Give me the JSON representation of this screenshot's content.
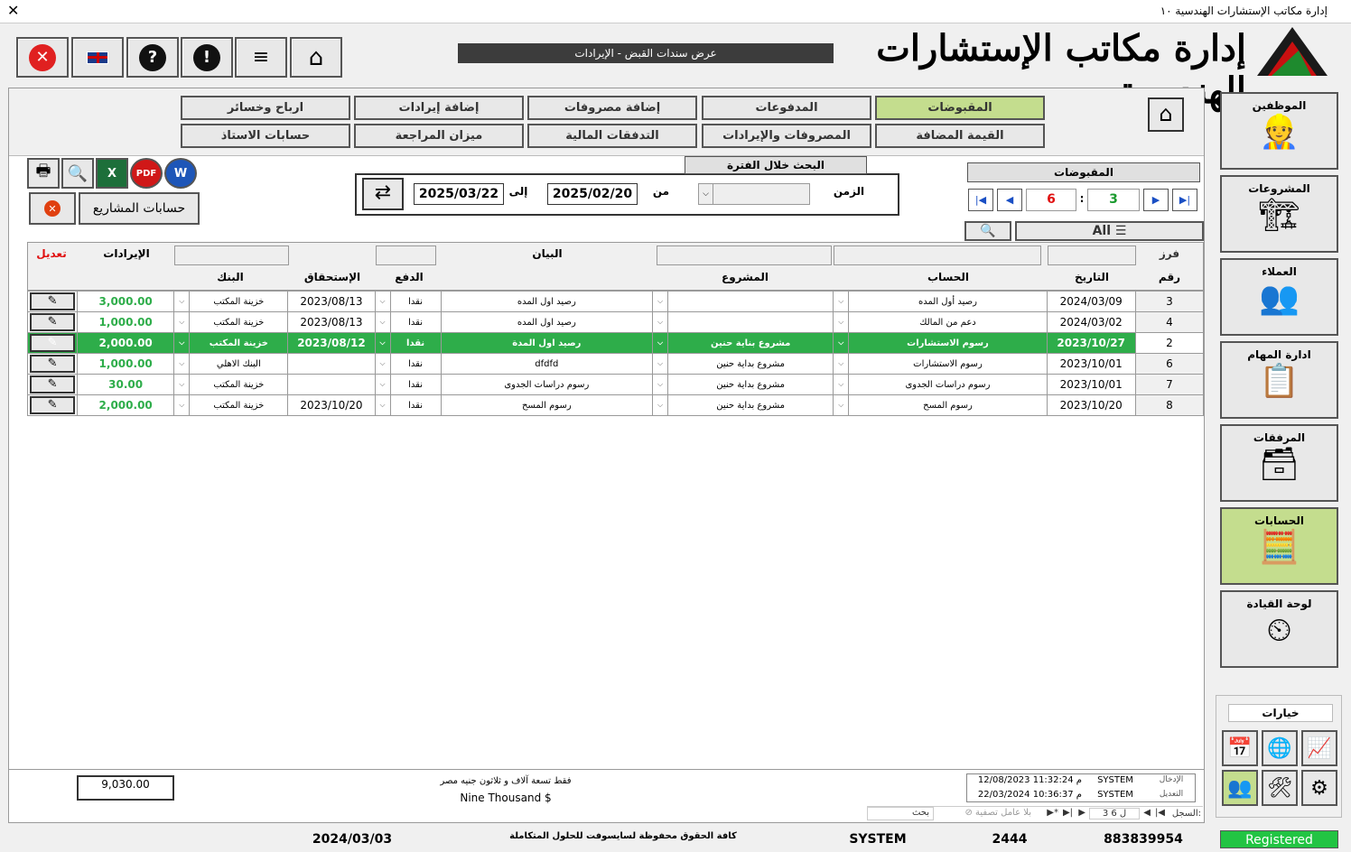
{
  "window": {
    "title": "إدارة مكاتب الإستشارات الهندسية ١٠"
  },
  "form_title": "عرض سندات القبض - الإيرادات",
  "logo_text": "إدارة مكاتب الإستشارات الهندسية",
  "tabs_row1": [
    "المقبوضات",
    "المدفوعات",
    "إضافة مصروفات",
    "إضافة إيرادات",
    "ارباح وخسائر"
  ],
  "tabs_row2": [
    "القيمة المضافة",
    "المصروفات والإيرادات",
    "التدفقات المالية",
    "ميزان المراجعة",
    "حسابات الاستاذ"
  ],
  "side": [
    "الموظفين",
    "المشروعات",
    "العملاء",
    "ادارة المهام",
    "المرفقات",
    "الحسابات",
    "لوحة القيادة"
  ],
  "options_label": "خيارات",
  "projects_accounts": "حسابات المشاريع",
  "search_period": {
    "title": "البحث خلال الفترة",
    "time_label": "الزمن",
    "from_label": "من",
    "to_label": "إلى",
    "from": "2025/02/20",
    "to": "2025/03/22"
  },
  "nav": {
    "title": "المقبوضات",
    "current": "3",
    "total": "6",
    "sep": ":"
  },
  "filter_all": "All",
  "sort_label": "فرز",
  "num_label": "رقم",
  "edit_label": "تعديل",
  "headers": {
    "income": "الإيرادات",
    "bank": "البنك",
    "due": "الإستحقاق",
    "pay": "الدفع",
    "statement": "البيان",
    "project": "المشروع",
    "account": "الحساب",
    "date": "التاريخ"
  },
  "rows": [
    {
      "num": "3",
      "date": "2024/03/09",
      "account": "رصيد أول المده",
      "project": "",
      "statement": "رصيد اول المده",
      "pay": "نقدا",
      "due": "2023/08/13",
      "bank": "خزينة المكتب",
      "income": "3,000.00"
    },
    {
      "num": "4",
      "date": "2024/03/02",
      "account": "دعم من المالك",
      "project": "",
      "statement": "رصيد اول المده",
      "pay": "نقدا",
      "due": "2023/08/13",
      "bank": "خزينة المكتب",
      "income": "1,000.00"
    },
    {
      "num": "2",
      "date": "2023/10/27",
      "account": "رسوم الاستشارات",
      "project": "مشروع بناية حنين",
      "statement": "رصيد اول المدة",
      "pay": "نقدا",
      "due": "2023/08/12",
      "bank": "خزينة المكتب",
      "income": "2,000.00"
    },
    {
      "num": "6",
      "date": "2023/10/01",
      "account": "رسوم الاستشارات",
      "project": "مشروع بداية حنين",
      "statement": "dfdfd",
      "pay": "نقدا",
      "due": "",
      "bank": "البنك الاهلي",
      "income": "1,000.00"
    },
    {
      "num": "7",
      "date": "2023/10/01",
      "account": "رسوم دراسات الجدوى",
      "project": "مشروع بداية حنين",
      "statement": "رسوم دراسات الجدوى",
      "pay": "نقدا",
      "due": "",
      "bank": "خزينة المكتب",
      "income": "30.00"
    },
    {
      "num": "8",
      "date": "2023/10/20",
      "account": "رسوم المسح",
      "project": "مشروع بداية حنين",
      "statement": "رسوم المسح",
      "pay": "نقدا",
      "due": "2023/10/20",
      "bank": "خزينة المكتب",
      "income": "2,000.00"
    }
  ],
  "selected_row": 2,
  "total": "9,030.00",
  "total_words_ar": "فقط تسعة آلاف و ثلاثون جنيه مصر",
  "total_words_en": "Nine Thousand $",
  "audit": {
    "entry_label": "الإدخال",
    "edit_label": "التعديل",
    "entry_user": "SYSTEM",
    "edit_user": "SYSTEM",
    "entry_time": "12/08/2023 11:32:24 م",
    "edit_time": "22/03/2024 10:36:37 م"
  },
  "record_nav": {
    "label": "السجل:",
    "pos": "3 ل 6",
    "filter": "بلا عامل تصفية",
    "search": "بحث"
  },
  "status": {
    "date": "2024/03/03",
    "rights": "كافة الحقوق محفوظة لسايسوفت للحلول المتكاملة",
    "user": "SYSTEM",
    "code": "2444",
    "phone": "883839954",
    "registered": "Registered"
  },
  "colors": {
    "selected": "#2ead4a",
    "active_tab": "#c4dd8e",
    "registered": "#22c443"
  }
}
